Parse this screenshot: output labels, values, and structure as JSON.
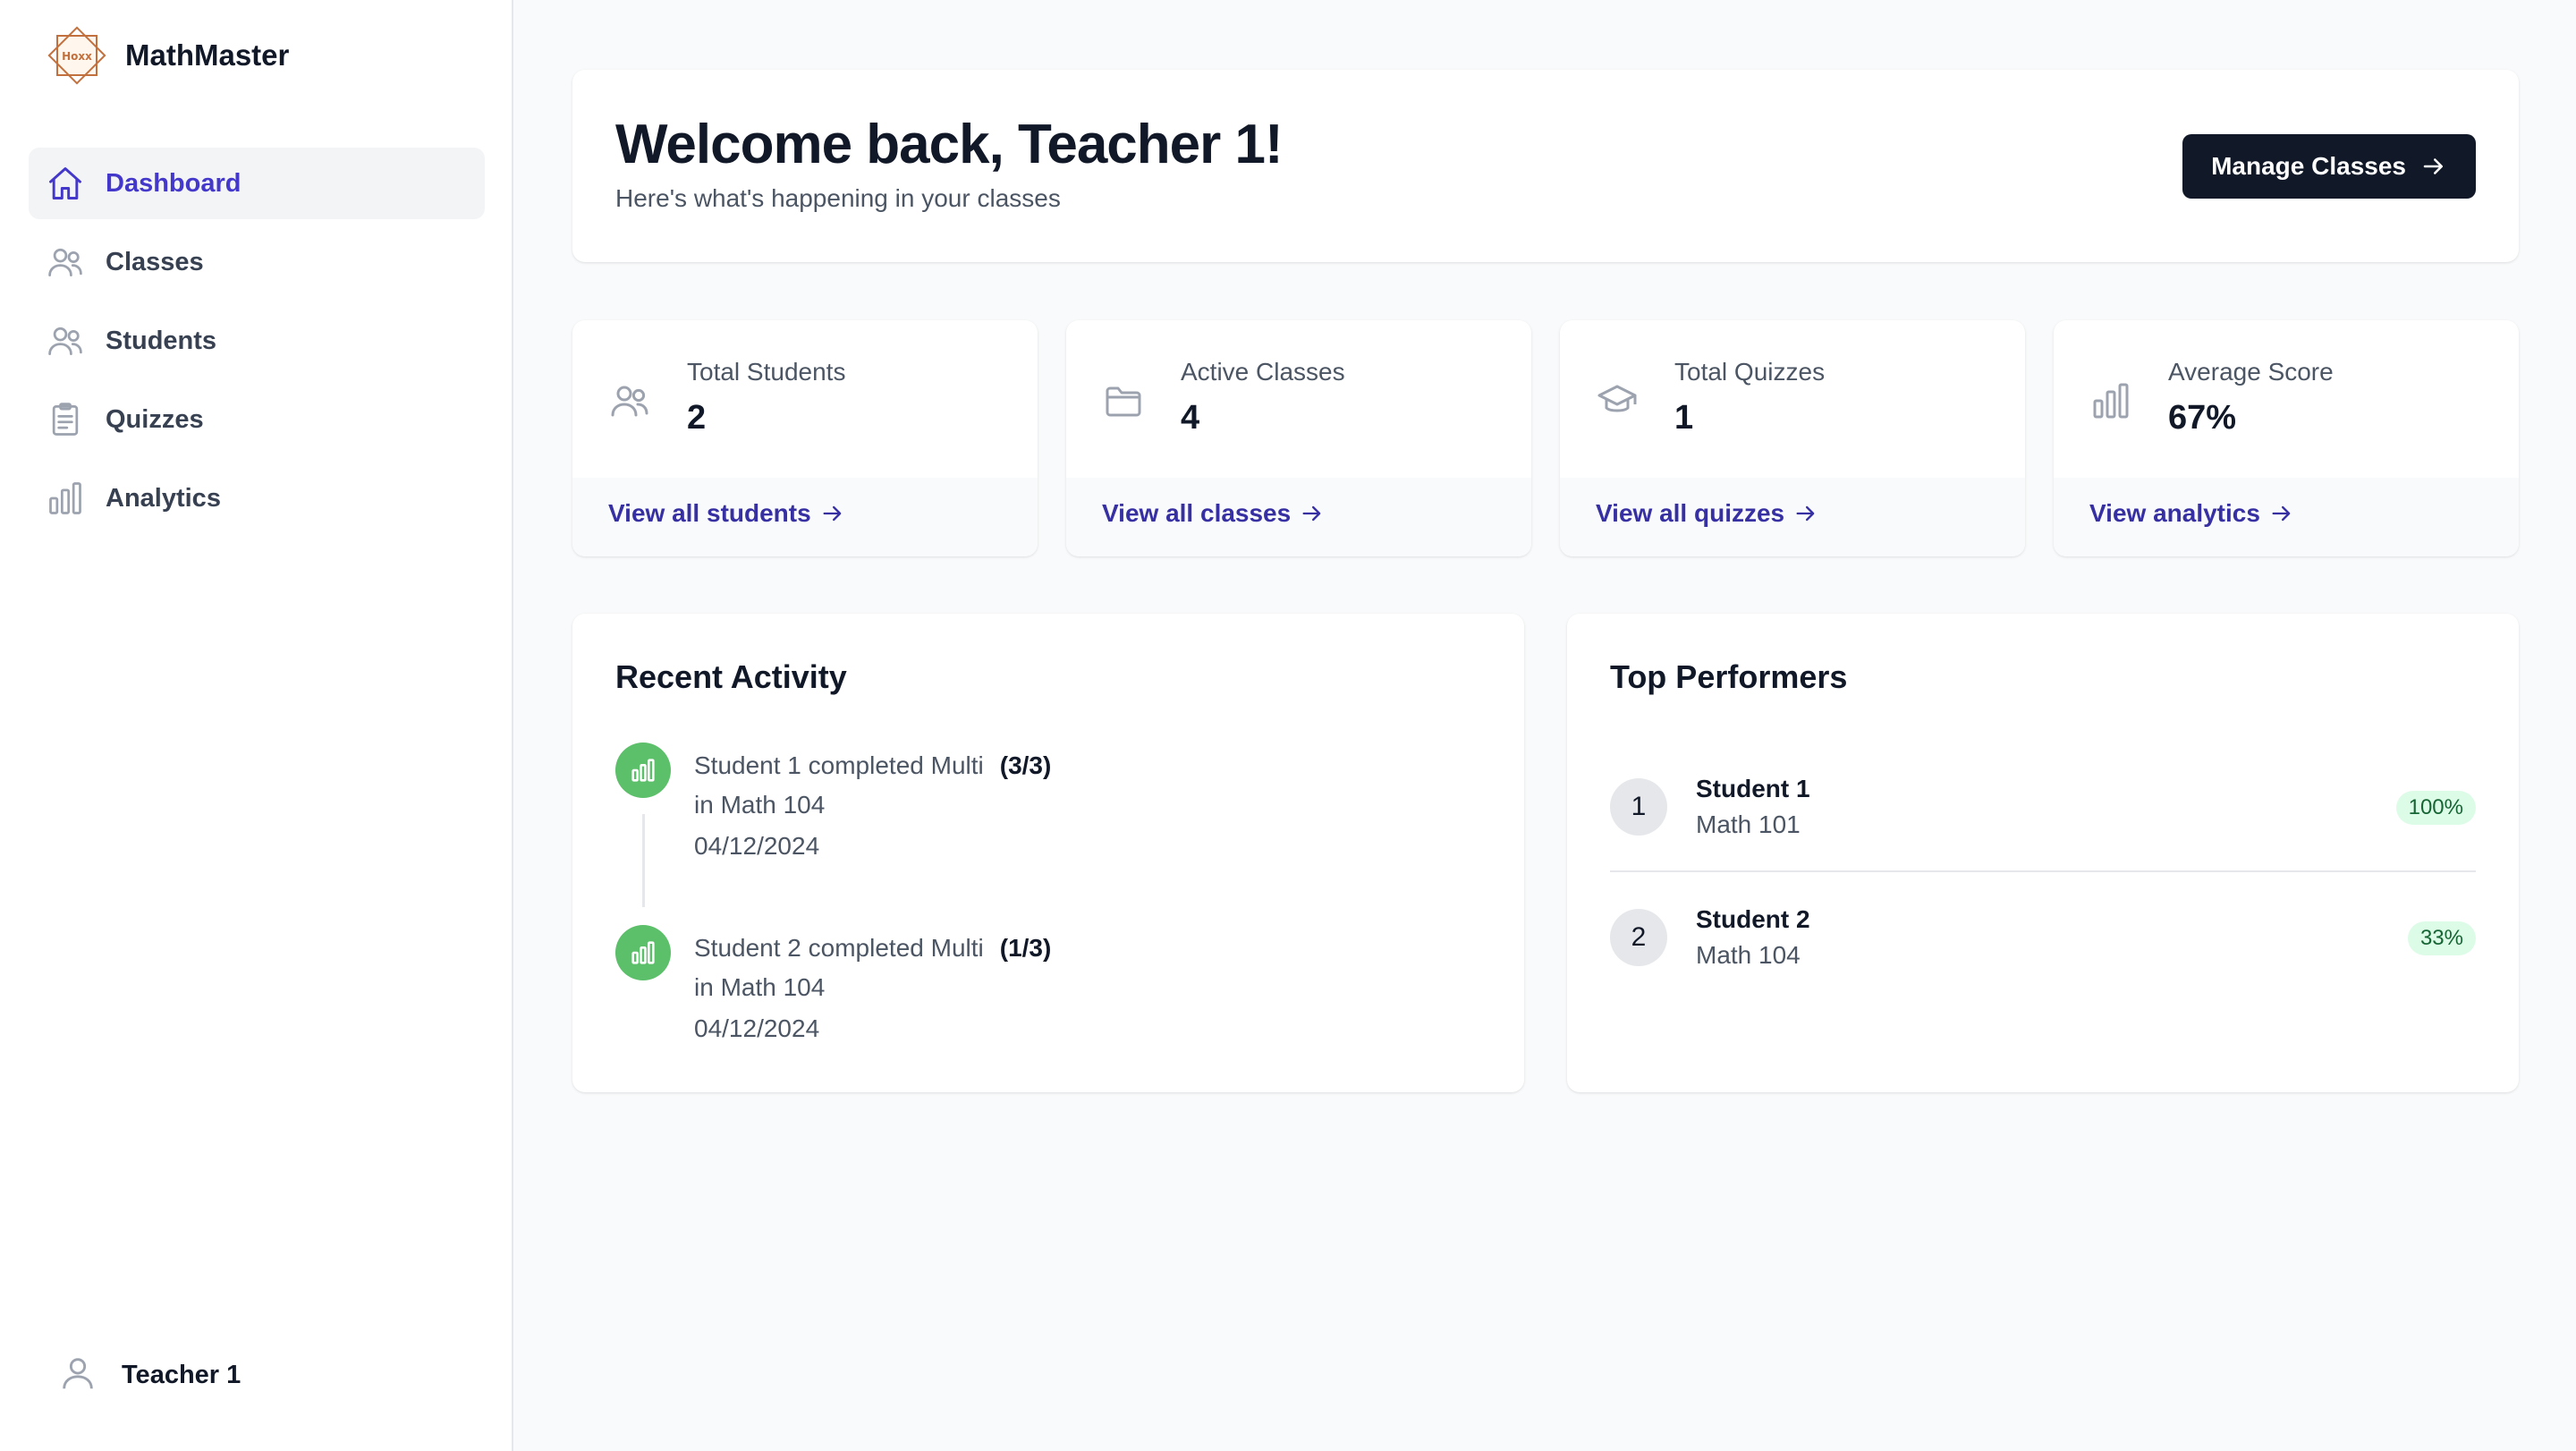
{
  "app": {
    "name": "MathMaster",
    "logo_text": "Hoxx"
  },
  "sidebar": {
    "items": [
      {
        "label": "Dashboard",
        "icon": "home-icon",
        "active": true
      },
      {
        "label": "Classes",
        "icon": "users-icon",
        "active": false
      },
      {
        "label": "Students",
        "icon": "users-icon",
        "active": false
      },
      {
        "label": "Quizzes",
        "icon": "clipboard-icon",
        "active": false
      },
      {
        "label": "Analytics",
        "icon": "bar-chart-icon",
        "active": false
      }
    ],
    "user": {
      "name": "Teacher 1",
      "icon": "user-icon"
    }
  },
  "welcome": {
    "title": "Welcome back, Teacher 1!",
    "subtitle": "Here's what's happening in your classes",
    "button_label": "Manage Classes"
  },
  "stats": [
    {
      "label": "Total Students",
      "value": "2",
      "link": "View all students",
      "icon": "users-icon"
    },
    {
      "label": "Active Classes",
      "value": "4",
      "link": "View all classes",
      "icon": "folder-icon"
    },
    {
      "label": "Total Quizzes",
      "value": "1",
      "link": "View all quizzes",
      "icon": "graduation-cap-icon"
    },
    {
      "label": "Average Score",
      "value": "67%",
      "link": "View analytics",
      "icon": "bar-chart-icon"
    }
  ],
  "activity": {
    "title": "Recent Activity",
    "items": [
      {
        "text": "Student 1 completed Multi",
        "score": "(3/3)",
        "class": "in Math 104",
        "date": "04/12/2024"
      },
      {
        "text": "Student 2 completed Multi",
        "score": "(1/3)",
        "class": "in Math 104",
        "date": "04/12/2024"
      }
    ]
  },
  "performers": {
    "title": "Top Performers",
    "items": [
      {
        "rank": "1",
        "name": "Student 1",
        "class": "Math 101",
        "score": "100%"
      },
      {
        "rank": "2",
        "name": "Student 2",
        "class": "Math 104",
        "score": "33%"
      }
    ]
  },
  "colors": {
    "accent": "#4338ca",
    "link": "#3730a3",
    "success": "#5cbf6a",
    "dark_button": "#111827"
  }
}
